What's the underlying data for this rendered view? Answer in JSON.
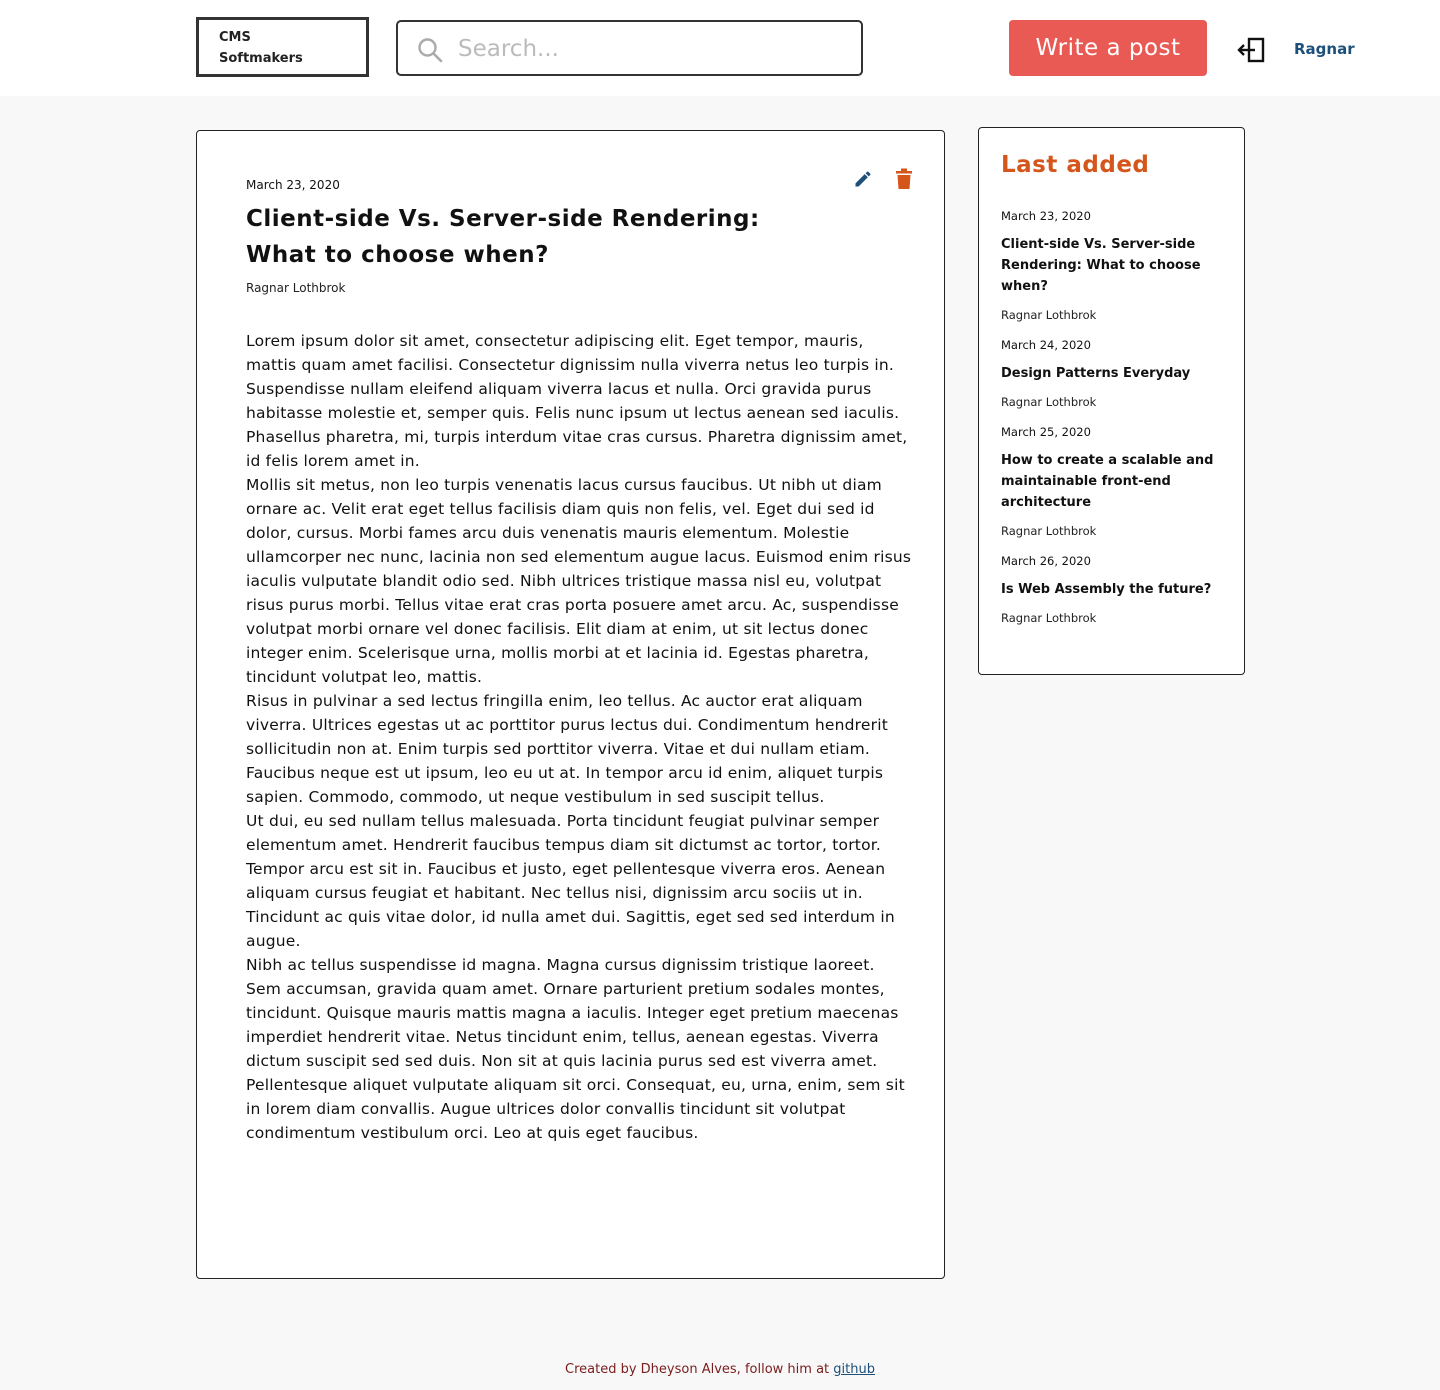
{
  "header": {
    "logo_line1": "CMS",
    "logo_line2": "Softmakers",
    "search_placeholder": "Search...",
    "write_button": "Write a post",
    "logout_icon": "logout-icon",
    "user_name": "Ragnar"
  },
  "post": {
    "date": "March 23, 2020",
    "title": "Client-side Vs. Server-side Rendering: What to choose when?",
    "author": "Ragnar Lothbrok",
    "paragraphs": [
      "Lorem ipsum dolor sit amet, consectetur adipiscing elit. Eget tempor, mauris, mattis quam amet facilisi. Consectetur dignissim nulla viverra netus leo turpis in. Suspendisse nullam eleifend aliquam viverra lacus et nulla. Orci gravida purus habitasse molestie et, semper quis. Felis nunc ipsum ut lectus aenean sed iaculis. Phasellus pharetra, mi, turpis interdum vitae cras cursus. Pharetra dignissim amet, id felis lorem amet in.",
      "Mollis sit metus, non leo turpis venenatis lacus cursus faucibus. Ut nibh ut diam ornare ac. Velit erat eget tellus facilisis diam quis non felis, vel. Eget dui sed id dolor, cursus. Morbi fames arcu duis venenatis mauris elementum. Molestie ullamcorper nec nunc, lacinia non sed elementum augue lacus. Euismod enim risus iaculis vulputate blandit odio sed. Nibh ultrices tristique massa nisl eu, volutpat risus purus morbi. Tellus vitae erat cras porta posuere amet arcu. Ac, suspendisse volutpat morbi ornare vel donec facilisis. Elit diam at enim, ut sit lectus donec integer enim. Scelerisque urna, mollis morbi at et lacinia id. Egestas pharetra, tincidunt volutpat leo, mattis.",
      "Risus in pulvinar a sed lectus fringilla enim, leo tellus. Ac auctor erat aliquam viverra. Ultrices egestas ut ac porttitor purus lectus dui. Condimentum hendrerit sollicitudin non at. Enim turpis sed porttitor viverra. Vitae et dui nullam etiam. Faucibus neque est ut ipsum, leo eu ut at. In tempor arcu id enim, aliquet turpis sapien. Commodo, commodo, ut neque vestibulum in sed suscipit tellus.",
      "Ut dui, eu sed nullam tellus malesuada. Porta tincidunt feugiat pulvinar semper elementum amet. Hendrerit faucibus tempus diam sit dictumst ac tortor, tortor. Tempor arcu est sit in. Faucibus et justo, eget pellentesque viverra eros. Aenean aliquam cursus feugiat et habitant. Nec tellus nisi, dignissim arcu sociis ut in. Tincidunt ac quis vitae dolor, id nulla amet dui. Sagittis, eget sed sed interdum in augue.",
      "Nibh ac tellus suspendisse id magna. Magna cursus dignissim tristique laoreet. Sem accumsan, gravida quam amet. Ornare parturient pretium sodales montes, tincidunt. Quisque mauris mattis magna a iaculis. Integer eget pretium maecenas imperdiet hendrerit vitae. Netus tincidunt enim, tellus, aenean egestas. Viverra dictum suscipit sed sed duis. Non sit at quis lacinia purus sed est viverra amet. Pellentesque aliquet vulputate aliquam sit orci. Consequat, eu, urna, enim, sem sit in lorem diam convallis. Augue ultrices dolor convallis tincidunt sit volutpat condimentum vestibulum orci. Leo at quis eget faucibus."
    ],
    "edit_icon": "pencil-icon",
    "delete_icon": "trash-icon"
  },
  "sidebar": {
    "title": "Last added",
    "items": [
      {
        "date": "March 23, 2020",
        "title": "Client-side Vs. Server-side Rendering: What to choose when?",
        "author": "Ragnar Lothbrok"
      },
      {
        "date": "March 24, 2020",
        "title": "Design Patterns Everyday",
        "author": "Ragnar Lothbrok"
      },
      {
        "date": "March 25, 2020",
        "title": "How to create a scalable and maintainable front-end architecture",
        "author": "Ragnar Lothbrok"
      },
      {
        "date": "March 26, 2020",
        "title": "Is Web Assembly the future?",
        "author": "Ragnar Lothbrok"
      }
    ]
  },
  "footer": {
    "text": "Created by Dheyson Alves, follow him at",
    "link": "github"
  },
  "colors": {
    "accent": "#e85a53",
    "sidebar_title": "#d4561b",
    "link": "#1d4f7a",
    "footer_text": "#7b1d1d"
  }
}
